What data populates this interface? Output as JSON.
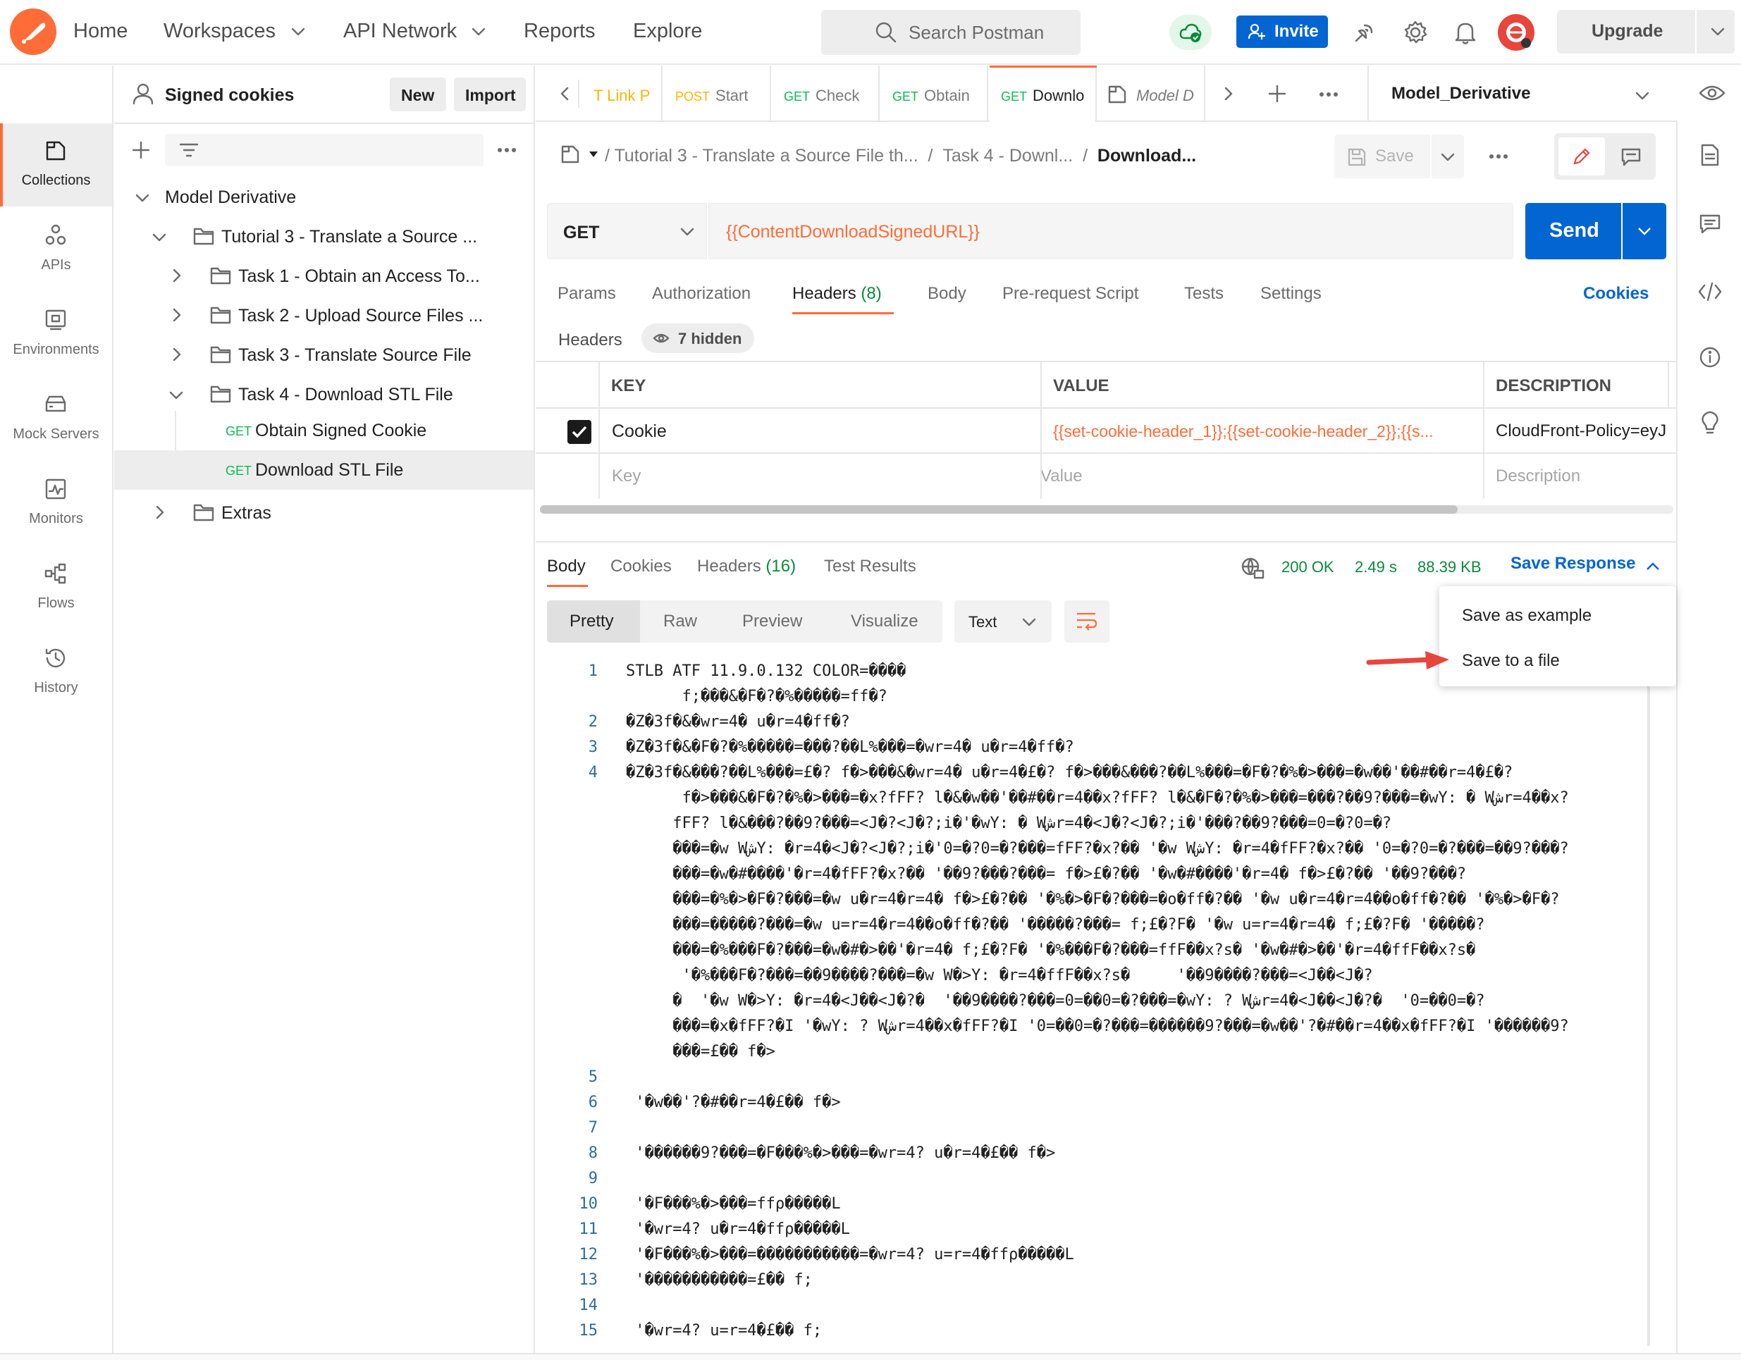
{
  "topnav": {
    "home": "Home",
    "workspaces": "Workspaces",
    "api_network": "API Network",
    "reports": "Reports",
    "explore": "Explore",
    "search_placeholder": "Search Postman",
    "invite": "Invite",
    "upgrade": "Upgrade"
  },
  "rail": [
    {
      "label": "Collections"
    },
    {
      "label": "APIs"
    },
    {
      "label": "Environments"
    },
    {
      "label": "Mock Servers"
    },
    {
      "label": "Monitors"
    },
    {
      "label": "Flows"
    },
    {
      "label": "History"
    }
  ],
  "sidebar": {
    "workspace": "Signed cookies",
    "new": "New",
    "import": "Import",
    "tree": {
      "collection": "Model Derivative",
      "tutorial": "Tutorial 3 - Translate a Source ...",
      "task1": "Task 1 - Obtain an Access To...",
      "task2": "Task 2 - Upload Source Files ...",
      "task3": "Task 3 - Translate Source File",
      "task4": "Task 4 - Download STL File",
      "req1_method": "GET",
      "req1": "Obtain Signed Cookie",
      "req2_method": "GET",
      "req2": "Download STL File",
      "extras": "Extras"
    }
  },
  "tabs": [
    {
      "method": "",
      "label": "T Link P"
    },
    {
      "method": "POST",
      "label": "Start"
    },
    {
      "method": "GET",
      "label": "Check"
    },
    {
      "method": "GET",
      "label": "Obtain"
    },
    {
      "method": "GET",
      "label": "Downlo"
    },
    {
      "method": "",
      "label": "Model D"
    }
  ],
  "environment": "Model_Derivative",
  "breadcrumb": {
    "part1": "Tutorial 3 - Translate a Source File th...",
    "part2": "Task 4 - Downl...",
    "current": "Download...",
    "save": "Save"
  },
  "request": {
    "method": "GET",
    "url": "{{ContentDownloadSignedURL}}",
    "send": "Send"
  },
  "req_tabs": {
    "params": "Params",
    "authorization": "Authorization",
    "headers": "Headers",
    "headers_count": "(8)",
    "body": "Body",
    "prerequest": "Pre-request Script",
    "tests": "Tests",
    "settings": "Settings",
    "cookies": "Cookies"
  },
  "headers_section": {
    "title": "Headers",
    "hidden": "7 hidden",
    "col_key": "KEY",
    "col_value": "VALUE",
    "col_desc": "DESCRIPTION",
    "row_key": "Cookie",
    "row_value": "{{set-cookie-header_1}};{{set-cookie-header_2}};{{s...",
    "row_desc": "CloudFront-Policy=eyJ",
    "ph_key": "Key",
    "ph_value": "Value",
    "ph_desc": "Description"
  },
  "response": {
    "body": "Body",
    "cookies": "Cookies",
    "headers": "Headers",
    "headers_count": "(16)",
    "test_results": "Test Results",
    "status": "200 OK",
    "time": "2.49 s",
    "size": "88.39 KB",
    "save_response": "Save Response",
    "pretty": "Pretty",
    "raw": "Raw",
    "preview": "Preview",
    "visualize": "Visualize",
    "format": "Text"
  },
  "menu": {
    "save_example": "Save as example",
    "save_file": "Save to a file"
  },
  "code_lines": [
    {
      "n": "1",
      "rows": [
        "STLB ATF 11.9.0.132 COLOR=����",
        "      f;���&�F�?�%�����=ff�?"
      ]
    },
    {
      "n": "2",
      "rows": [
        "�Z�3f�&�wr=4� u�r=4�ff�?"
      ]
    },
    {
      "n": "3",
      "rows": [
        "�Z�3f�&�F�?�%�����=���?��L%���=�wr=4� u�r=4�ff�?"
      ]
    },
    {
      "n": "4",
      "rows": [
        "�Z�3f�&���?��L%���=£�? f�>���&�wr=4� u�r=4�£�? f�>���&���?��L%���=�F�?�%�>���=�w��'��#��r=4�£�?",
        "      f�>���&�F�?�%�>���=�x?fFF? l�&�w��'��#��r=4��x?fFF? l�&�F�?�%�>���=���?��9?���=�wY: � Wشr=4��x?",
        "     fFF? l�&���?��9?���=<J�?<J�?;i�'�wY: � Wشr=4�<J�?<J�?;i�'���?��9?���=0=�?0=�?",
        "     ���=�w WشY: �r=4�<J�?<J�?;i�'0=�?0=�?���=fFF?�x?�� '�w WشY: �r=4�fFF?�x?�� '0=�?0=�?���=��9?���?",
        "     ���=�w�#����'�r=4�fFF?�x?�� '��9?���?���= f�>£�?�� '�w�#����'�r=4� f�>£�?�� '��9?���?",
        "     ���=�%�>�F�?���=�w u�r=4�r=4� f�>£�?�� '�%�>�F�?���=�o�ff�?�� '�w u�r=4�r=4��o�ff�?�� '�%�>�F�?",
        "     ���=�����?���=�w u=r=4�r=4��o�ff�?�� '�����?���= f;£�?F� '�w u=r=4�r=4� f;£�?F� '�����?",
        "     ���=�%���F�?���=�w�#�>��'�r=4� f;£�?F� '�%���F�?���=ffF��x?s� '�w�#�>��'�r=4�ffF��x?s�",
        "      '�%���F�?���=��9����?���=�w W�>Y: �r=4�ffF��x?s�     '��9����?���=<J��<J�?",
        "     �  '�w W�>Y: �r=4�<J��<J�?�  '��9����?���=0=��0=�?���=�wY: ? Wشr=4�<J��<J�?�  '0=��0=�?",
        "     ���=�x�fFF?�I '�wY: ? Wشr=4��x�fFF?�I '0=��0=�?���=������9?���=�w��'?�#��r=4��x�fFF?�I '������9?",
        "     ���=£�� f�>"
      ]
    },
    {
      "n": "5",
      "rows": [
        ""
      ]
    },
    {
      "n": "6",
      "rows": [
        " '�w��'?�#��r=4�£�� f�>"
      ]
    },
    {
      "n": "7",
      "rows": [
        ""
      ]
    },
    {
      "n": "8",
      "rows": [
        " '������9?���=�F���%�>���=�wr=4? u�r=4�£�� f�>"
      ]
    },
    {
      "n": "9",
      "rows": [
        ""
      ]
    },
    {
      "n": "10",
      "rows": [
        " '�F���%�>���=ffρ�����L"
      ]
    },
    {
      "n": "11",
      "rows": [
        " '�wr=4? u�r=4�ffρ�����L"
      ]
    },
    {
      "n": "12",
      "rows": [
        " '�F���%�>���=�����������=�wr=4? u=r=4�ffρ�����L"
      ]
    },
    {
      "n": "13",
      "rows": [
        " '�����������=£�� f;"
      ]
    },
    {
      "n": "14",
      "rows": [
        ""
      ]
    },
    {
      "n": "15",
      "rows": [
        " '�wr=4? u=r=4�£�� f;"
      ]
    }
  ],
  "colors": {
    "accent": "#ff6c37",
    "brand_blue": "#0265d2",
    "get_green": "#0cbb52",
    "post_yellow": "#ffb400",
    "variable_orange": "#ff6c37",
    "status_green": "#0a8a3b",
    "arrow_red": "#e8453c"
  }
}
